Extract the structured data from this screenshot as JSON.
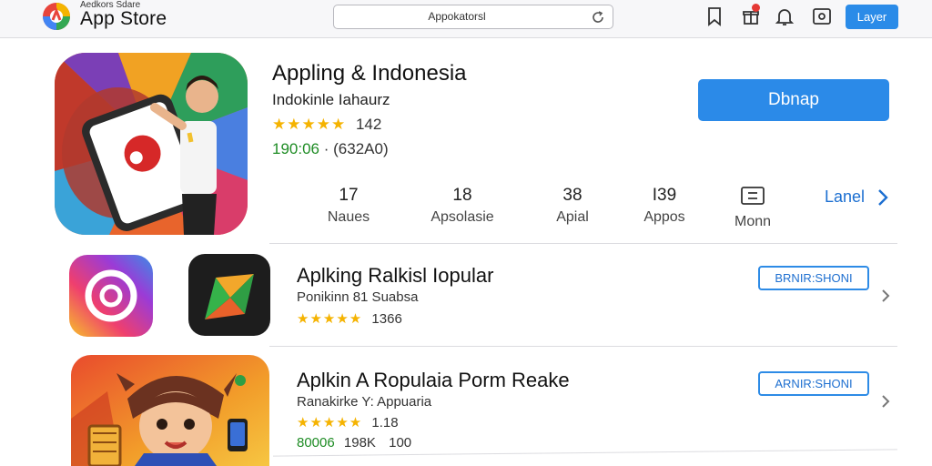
{
  "header": {
    "logo_subtitle": "Aedkors Sdare",
    "logo_title": "App Store",
    "search_value": "Appokatorsl",
    "action_button": "Layer"
  },
  "featured": {
    "title": "Appling & Indonesia",
    "developer": "Indokinle Iahaurz",
    "stars": "★★★★★",
    "rating_count": "142",
    "size": "190:06",
    "price": "(632A0)",
    "get_label": "Dbnap",
    "stats": [
      {
        "value": "17",
        "label": "Naues"
      },
      {
        "value": "18",
        "label": "Apsolasie"
      },
      {
        "value": "38",
        "label": "Apial"
      },
      {
        "value": "I39",
        "label": "Appos"
      },
      {
        "value": "",
        "label": "Monn"
      }
    ],
    "more_label": "Lanel"
  },
  "list": [
    {
      "title": "Aplking Ralkisl Iopular",
      "developer": "Ponikinn 81 Suabsa",
      "stars": "★★★★★",
      "rating_count": "1366",
      "button": "BRNIR:SHONI"
    },
    {
      "title": "Aplkin A Ropulaia Porm Reake",
      "developer": "Ranakirke Y: Appuaria",
      "stars": "★★★★★",
      "rating_count": "1.18",
      "size": "80006",
      "extra": "198K",
      "extra2": "100",
      "button": "ARNIR:SHONI"
    }
  ],
  "colors": {
    "accent": "#2b8ae8",
    "star": "#f5b301",
    "price_green": "#1e8c24",
    "link": "#1c6fd1"
  }
}
